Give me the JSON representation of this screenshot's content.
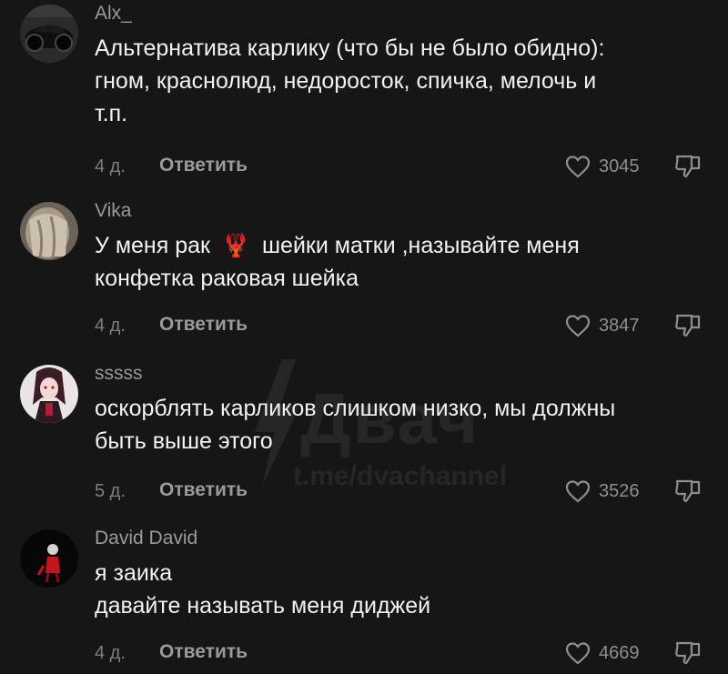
{
  "watermark": {
    "brand": "Двач",
    "url": "t.me/dvachannel"
  },
  "comments": [
    {
      "username": "Alx_",
      "text_lines": [
        "Альтернатива карлику (что бы не было обидно):",
        "гном, краснолюд, недоросток, спичка, мелочь и",
        "т.п."
      ],
      "age": "4 д.",
      "reply_label": "Ответить",
      "likes": "3045",
      "avatar": "motorcycle-avatar"
    },
    {
      "username": "Vika",
      "text_lines": [
        "У меня рак",
        "шейки матки ,называйте меня",
        "конфетка раковая шейка"
      ],
      "emoji": "🦞",
      "age": "4 д.",
      "reply_label": "Ответить",
      "likes": "3847",
      "avatar": "hair-avatar"
    },
    {
      "username": "sssss",
      "text_lines": [
        "оскорблять карликов слишком низко, мы должны",
        "быть выше этого"
      ],
      "age": "5 д.",
      "reply_label": "Ответить",
      "likes": "3526",
      "avatar": "anime-girl-avatar"
    },
    {
      "username": "David David",
      "text_lines": [
        "я заика",
        "давайте называть меня диджей"
      ],
      "age": "4 д.",
      "reply_label": "Ответить",
      "likes": "4669",
      "avatar": "dark-figure-avatar"
    }
  ],
  "colors": {
    "background": "#161616",
    "text": "#f2f2f2",
    "muted": "#9a9a9a",
    "icon": "#8f8f8f"
  }
}
